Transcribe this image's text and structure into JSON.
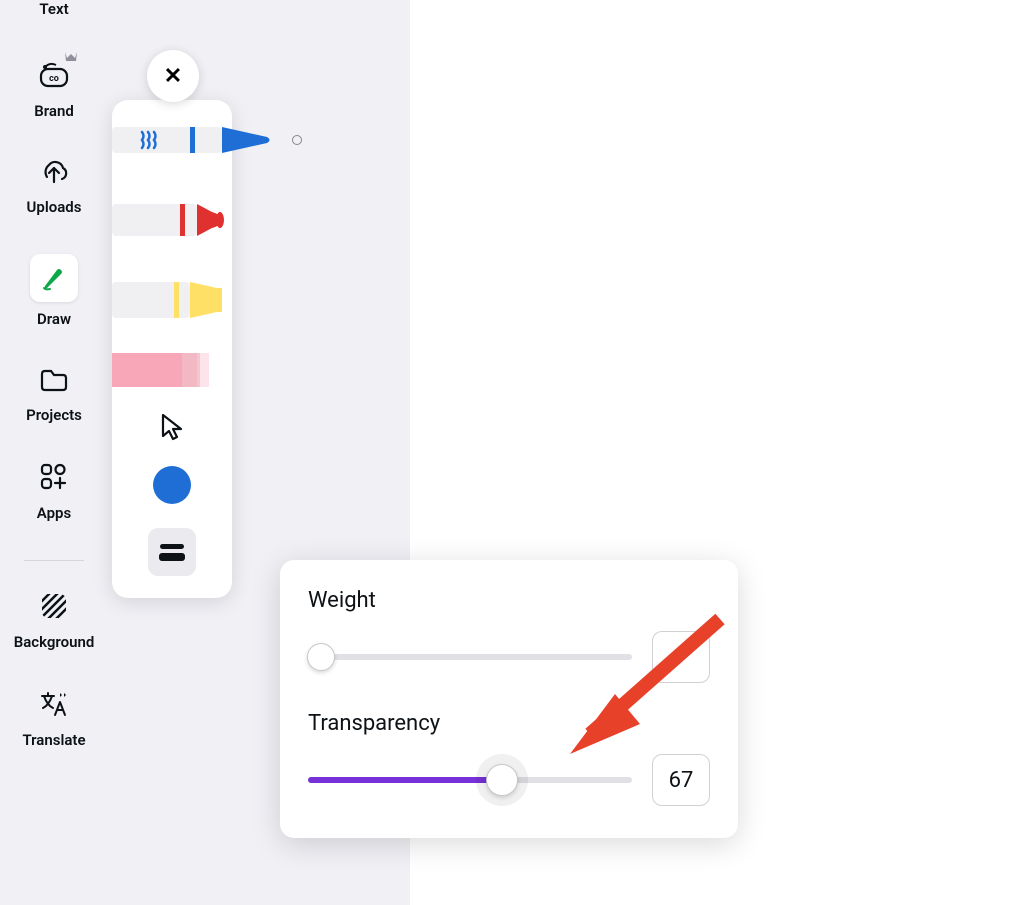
{
  "sidebar": {
    "items": [
      {
        "label": "Text"
      },
      {
        "label": "Brand"
      },
      {
        "label": "Uploads"
      },
      {
        "label": "Draw"
      },
      {
        "label": "Projects"
      },
      {
        "label": "Apps"
      },
      {
        "label": "Background"
      },
      {
        "label": "Translate"
      }
    ]
  },
  "drawPanel": {
    "closeGlyph": "✕"
  },
  "settings": {
    "weight": {
      "label": "Weight",
      "value": "",
      "percent": 2
    },
    "transparency": {
      "label": "Transparency",
      "value": "67",
      "percent": 60
    }
  },
  "colors": {
    "blue": "#1e6ed6",
    "red": "#e03131",
    "yellow": "#ffe066",
    "pink": "#f8a7b9",
    "green": "#0ba84a",
    "purple": "#7731d8",
    "arrowRed": "#e8412a"
  }
}
